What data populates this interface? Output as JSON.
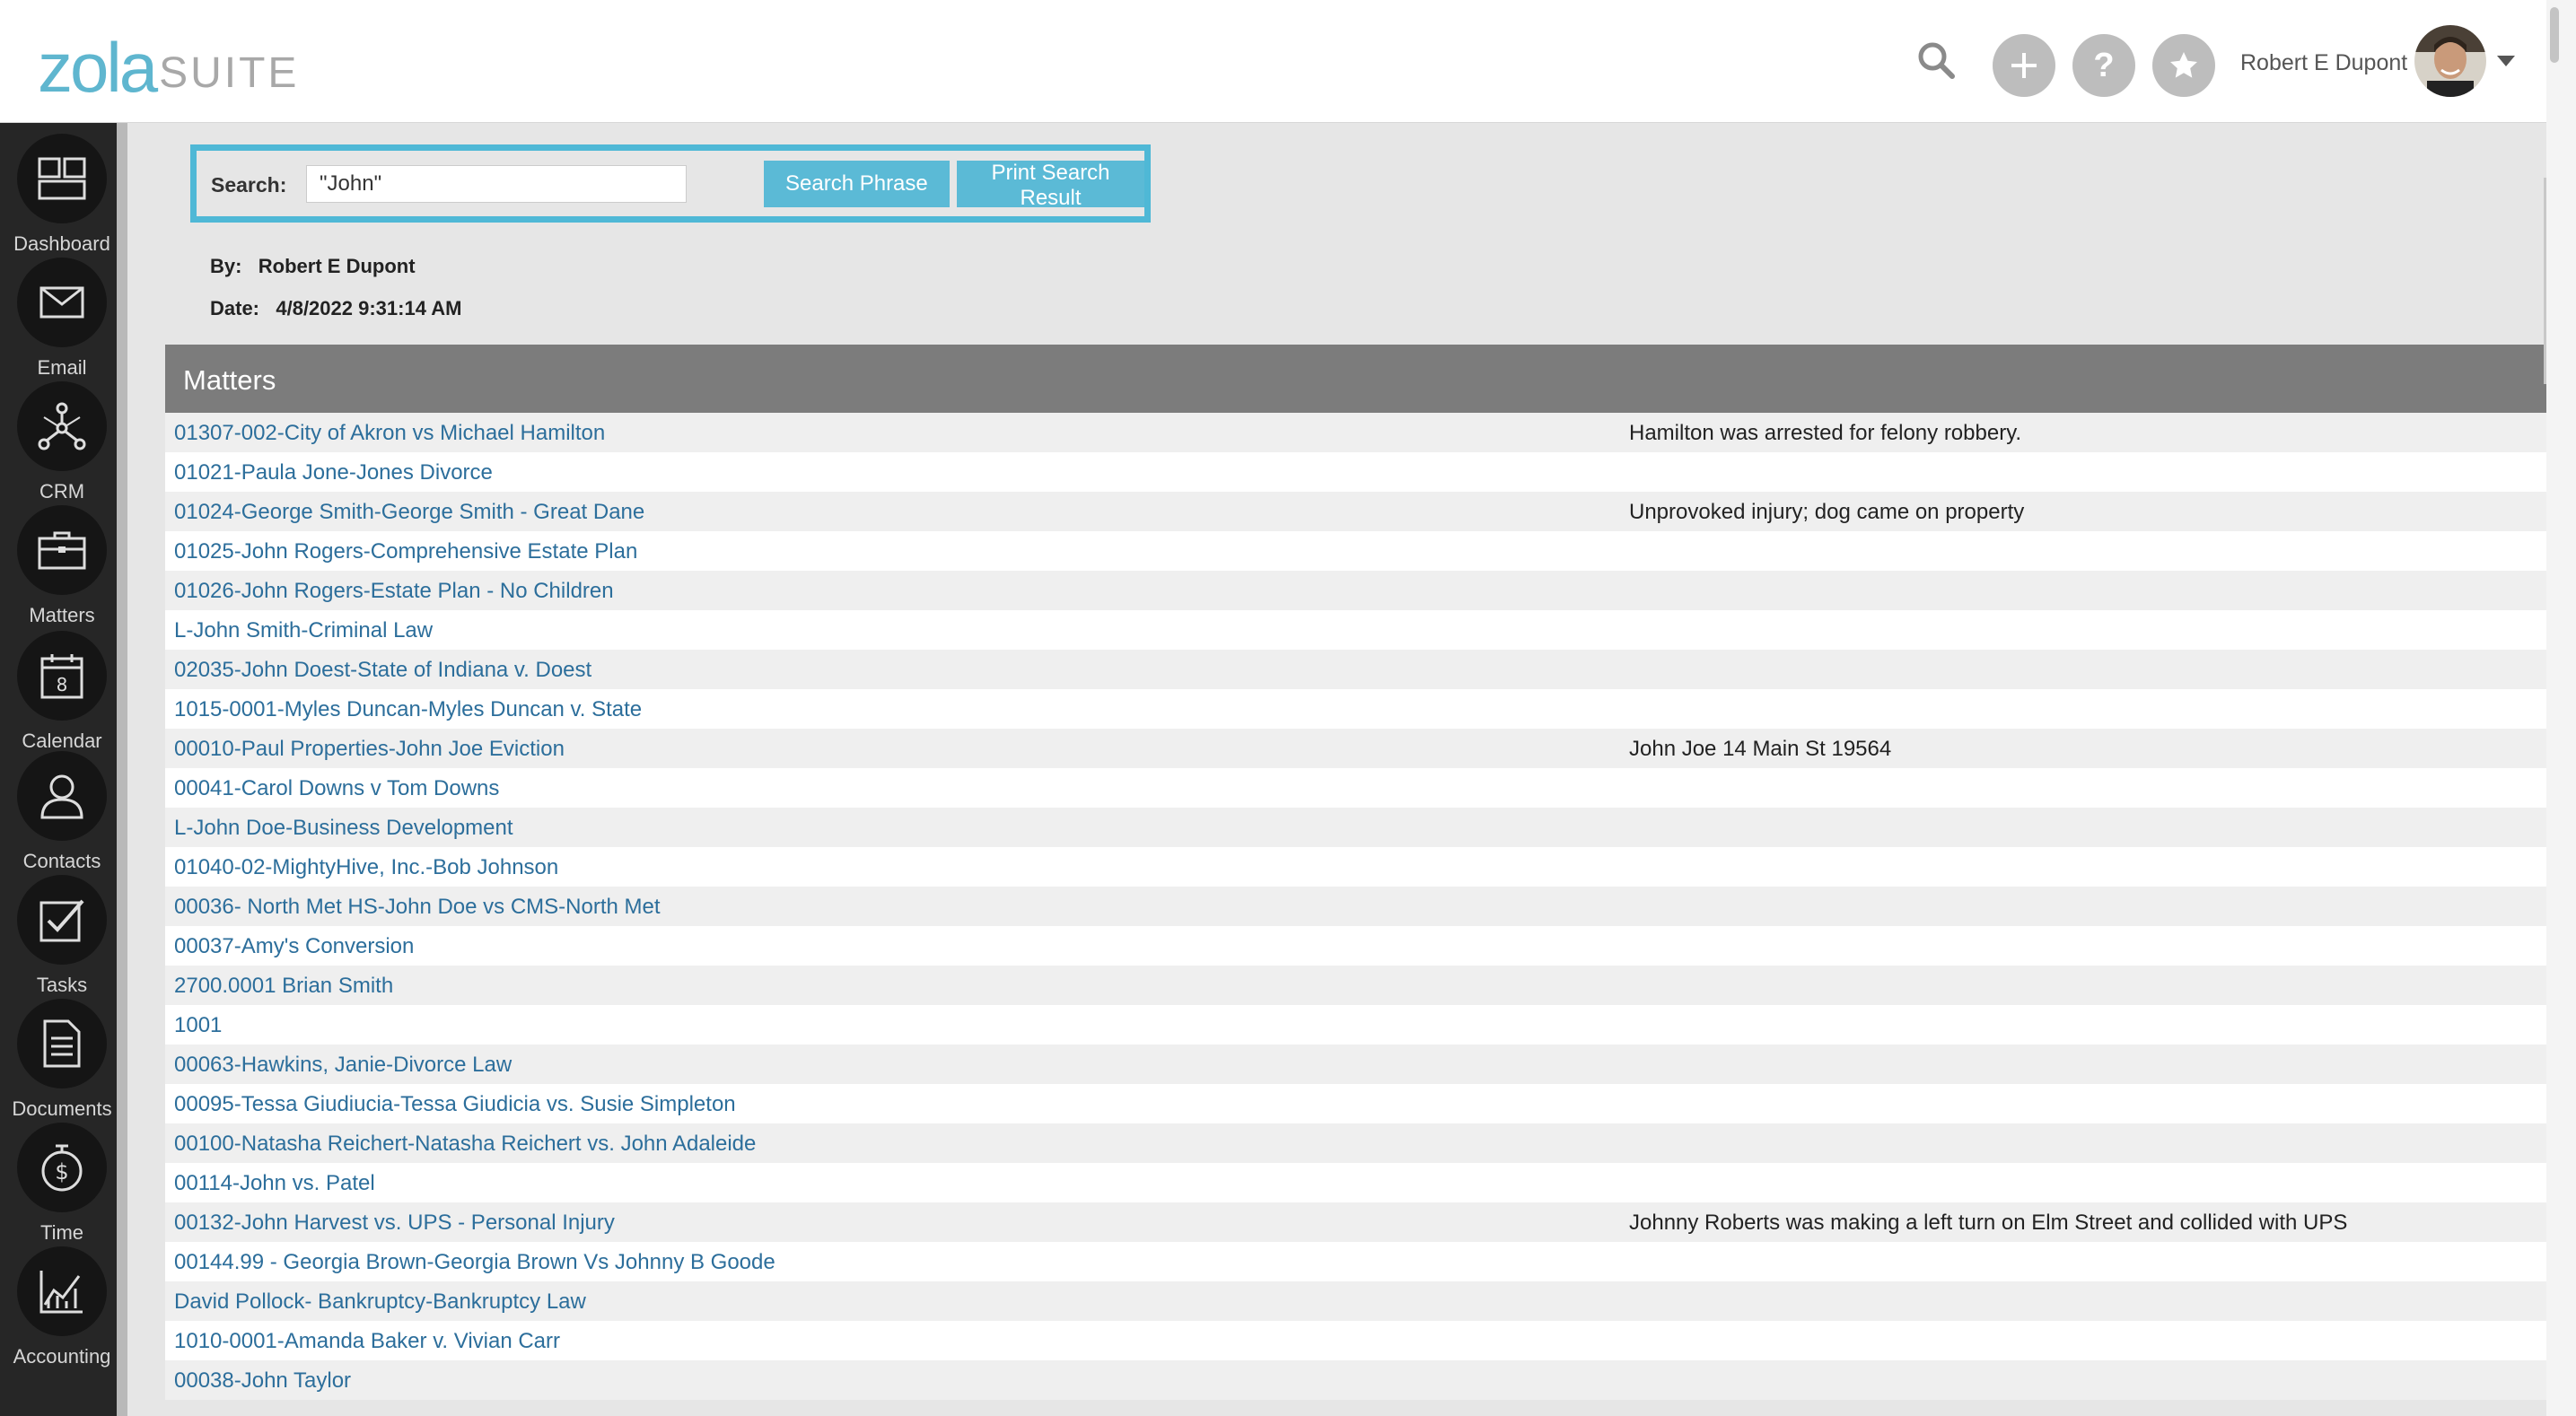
{
  "app": {
    "logo_primary": "zola",
    "logo_secondary": "SUITE",
    "user_name": "Robert E Dupont",
    "accent_color": "#4fb8d6",
    "sidebar_color": "#262626"
  },
  "header_icons": [
    "search-icon",
    "plus-icon",
    "question-icon",
    "star-icon"
  ],
  "sidebar": {
    "items": [
      {
        "label": "Dashboard",
        "icon": "dashboard-icon"
      },
      {
        "label": "Email",
        "icon": "envelope-icon"
      },
      {
        "label": "CRM",
        "icon": "network-icon"
      },
      {
        "label": "Matters",
        "icon": "briefcase-icon"
      },
      {
        "label": "Calendar",
        "icon": "calendar-icon"
      },
      {
        "label": "Contacts",
        "icon": "person-icon"
      },
      {
        "label": "Tasks",
        "icon": "checkbox-icon"
      },
      {
        "label": "Documents",
        "icon": "document-icon"
      },
      {
        "label": "Time",
        "icon": "stopwatch-icon"
      },
      {
        "label": "Accounting",
        "icon": "chart-icon"
      }
    ]
  },
  "search": {
    "label": "Search:",
    "value": "\"John\"",
    "search_button": "Search Phrase",
    "print_button": "Print Search Result"
  },
  "meta": {
    "by_label": "By:",
    "by_value": "Robert E Dupont",
    "date_label": "Date:",
    "date_value": "4/8/2022 9:31:14 AM"
  },
  "matters": {
    "title": "Matters",
    "rows": [
      {
        "name": "01307-002-City of Akron vs Michael Hamilton",
        "desc": "Hamilton was arrested for felony robbery."
      },
      {
        "name": "01021-Paula Jone-Jones Divorce",
        "desc": ""
      },
      {
        "name": "01024-George Smith-George Smith - Great Dane",
        "desc": "Unprovoked injury; dog came on property"
      },
      {
        "name": "01025-John Rogers-Comprehensive Estate Plan",
        "desc": ""
      },
      {
        "name": "01026-John Rogers-Estate Plan - No Children",
        "desc": ""
      },
      {
        "name": "L-John Smith-Criminal Law",
        "desc": ""
      },
      {
        "name": "02035-John Doest-State of Indiana v. Doest",
        "desc": ""
      },
      {
        "name": "1015-0001-Myles Duncan-Myles Duncan v. State",
        "desc": ""
      },
      {
        "name": "00010-Paul Properties-John Joe Eviction",
        "desc": "John Joe 14 Main St 19564"
      },
      {
        "name": "00041-Carol Downs v Tom Downs",
        "desc": ""
      },
      {
        "name": "L-John Doe-Business Development",
        "desc": ""
      },
      {
        "name": "01040-02-MightyHive, Inc.-Bob Johnson",
        "desc": ""
      },
      {
        "name": "00036- North Met HS-John Doe vs CMS-North Met",
        "desc": ""
      },
      {
        "name": "00037-Amy's Conversion",
        "desc": ""
      },
      {
        "name": "2700.0001 Brian Smith",
        "desc": ""
      },
      {
        "name": "1001",
        "desc": ""
      },
      {
        "name": "00063-Hawkins, Janie-Divorce Law",
        "desc": ""
      },
      {
        "name": "00095-Tessa Giudiucia-Tessa Giudicia vs. Susie Simpleton",
        "desc": ""
      },
      {
        "name": "00100-Natasha Reichert-Natasha Reichert vs. John Adaleide",
        "desc": ""
      },
      {
        "name": "00114-John vs. Patel",
        "desc": ""
      },
      {
        "name": "00132-John Harvest vs. UPS - Personal Injury",
        "desc": "Johnny Roberts was making a left turn on Elm Street and collided with UPS"
      },
      {
        "name": "00144.99 - Georgia Brown-Georgia Brown Vs Johnny B Goode",
        "desc": ""
      },
      {
        "name": "David Pollock- Bankruptcy-Bankruptcy Law",
        "desc": ""
      },
      {
        "name": "1010-0001-Amanda Baker v. Vivian Carr",
        "desc": ""
      },
      {
        "name": "00038-John Taylor",
        "desc": ""
      }
    ]
  }
}
